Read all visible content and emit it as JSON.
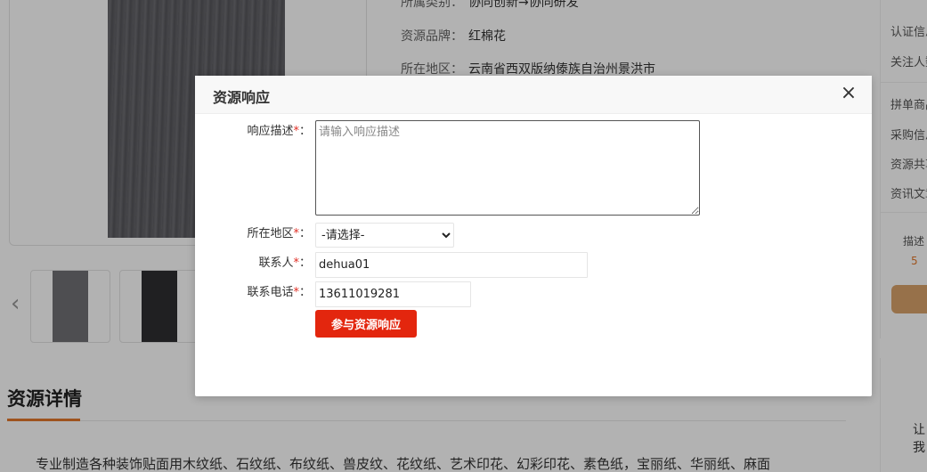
{
  "background": {
    "info": [
      {
        "label": "所属类别：",
        "value": "协同创新→协同研发"
      },
      {
        "label": "资源品牌：",
        "value": "红棉花"
      },
      {
        "label": "所在地区：",
        "value": "云南省西双版纳傣族自治州景洪市"
      }
    ],
    "sidebar": [
      "认证信息",
      "关注人数",
      "拼单商品",
      "采购信息",
      "资源共享",
      "资讯文章"
    ],
    "sidebar_desc_label": "描述",
    "sidebar_desc_value": "5",
    "sidebar2_text": "让我",
    "thumb_prev": "‹",
    "detail_title": "资源详情",
    "detail_text": "专业制造各种装饰贴面用木纹纸、石纹纸、布纹纸、兽皮纹、花纹纸、艺术印花、幻彩印花、素色纸，宝丽纸、华丽纸、麻面"
  },
  "modal": {
    "title": "资源响应",
    "close_icon": "×",
    "required_mark": "*",
    "description": {
      "label": "响应描述",
      "placeholder": "请输入响应描述",
      "value": ""
    },
    "region": {
      "label": "所在地区",
      "selected": "-请选择-"
    },
    "contact": {
      "label": "联系人",
      "value": "dehua01"
    },
    "phone": {
      "label": "联系电话",
      "value": "13611019281"
    },
    "submit_label": "参与资源响应"
  },
  "colors": {
    "accent": "#e3260e",
    "required": "#e02e24",
    "brand_orange": "#e3772c"
  }
}
